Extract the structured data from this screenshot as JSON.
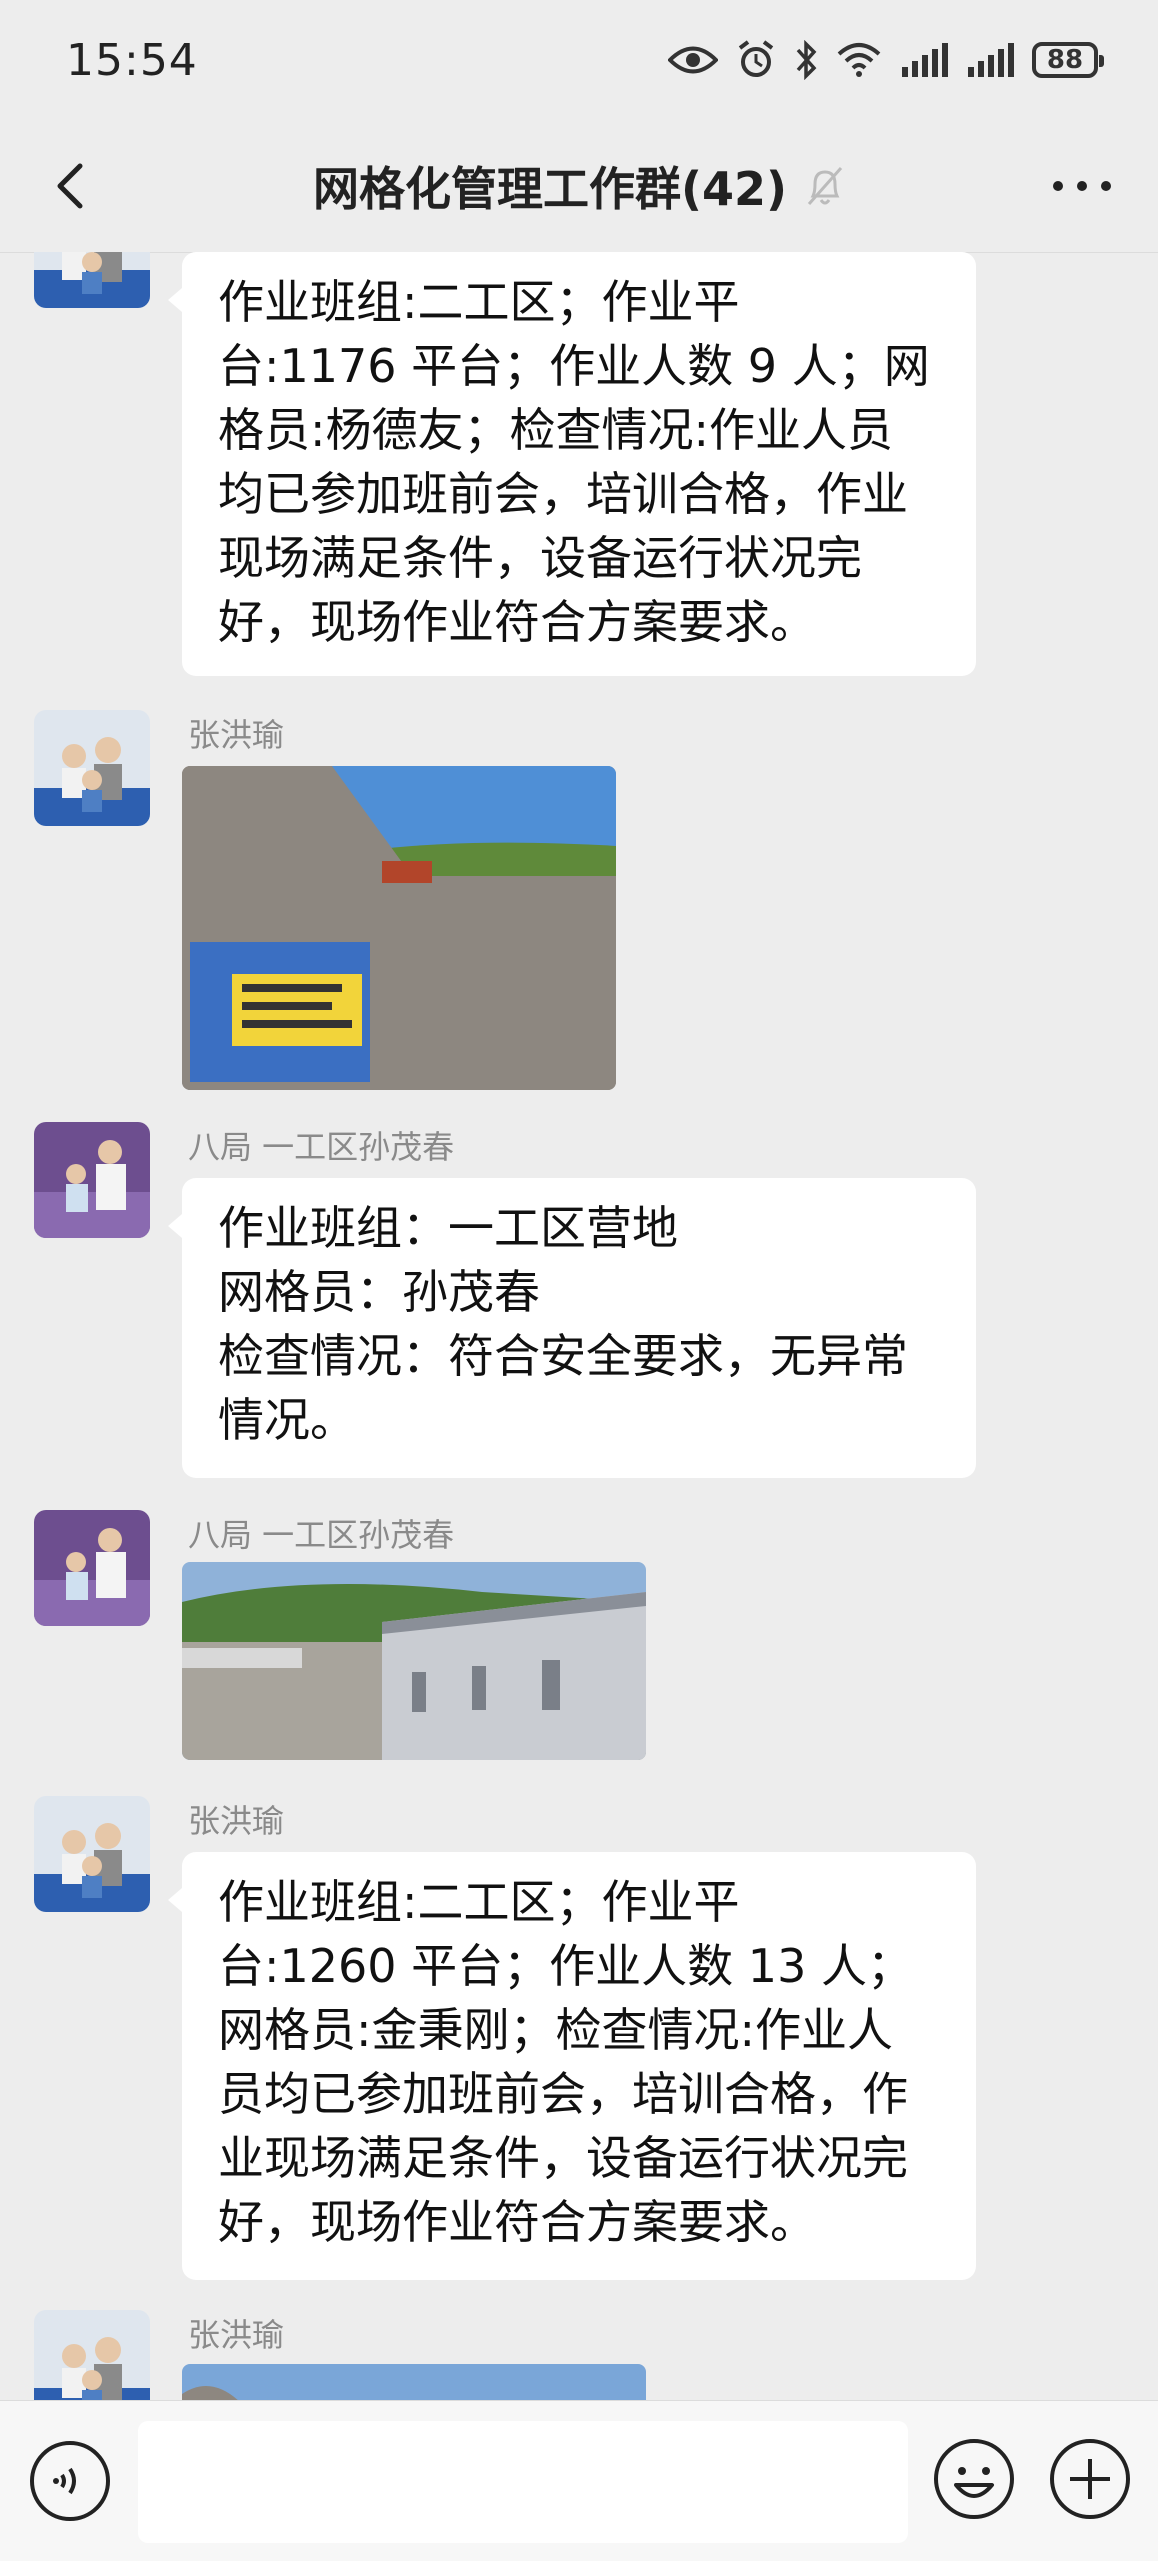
{
  "status_bar": {
    "time": "15:54",
    "battery": "88"
  },
  "header": {
    "title": "网格化管理工作群(42)",
    "muted": true
  },
  "messages": [
    {
      "type": "text",
      "sender": "",
      "text": "作业班组:二工区；作业平\n台:1176 平台；作业人数 9 人；网\n格员:杨德友；检查情况:作业人员\n均已参加班前会，培训合格，作业\n现场满足条件，设备运行状况完\n好，现场作业符合方案要求。"
    },
    {
      "type": "image",
      "sender": "张洪瑜"
    },
    {
      "type": "text",
      "sender": "八局 一工区孙茂春",
      "text": "作业班组：一工区营地\n网格员：孙茂春\n检查情况：符合安全要求，无异常\n情况。"
    },
    {
      "type": "image",
      "sender": "八局 一工区孙茂春"
    },
    {
      "type": "text",
      "sender": "张洪瑜",
      "text": "作业班组:二工区；作业平\n台:1260 平台；作业人数 13 人；\n网格员:金秉刚；检查情况:作业人\n员均已参加班前会，培训合格，作\n业现场满足条件，设备运行状况完\n好，现场作业符合方案要求。"
    },
    {
      "type": "image",
      "sender": "张洪瑜"
    }
  ],
  "input_bar": {
    "placeholder": ""
  },
  "icons": {
    "back": "back-arrow-icon",
    "more": "more-icon",
    "mute": "bell-off-icon",
    "voice": "voice-icon",
    "emoji": "emoji-icon",
    "plus": "plus-icon"
  },
  "colors": {
    "background": "#ededed",
    "bubble": "#ffffff",
    "sender_name": "#8a8a8a"
  }
}
